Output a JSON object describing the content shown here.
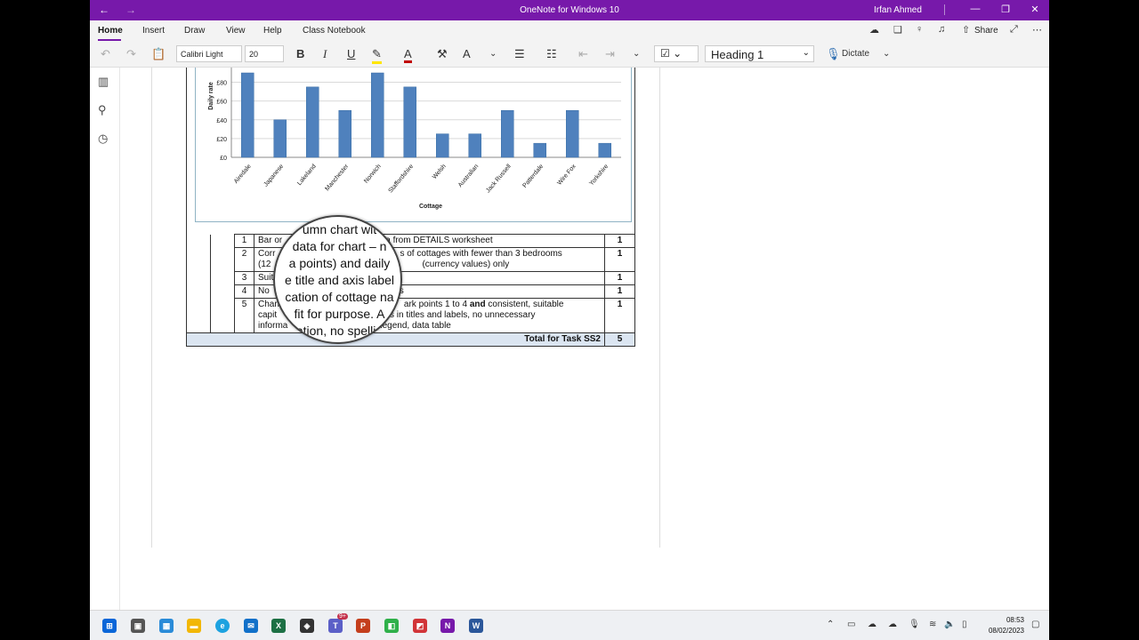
{
  "window": {
    "title": "OneNote for Windows 10",
    "user": "Irfan Ahmed"
  },
  "menu": {
    "items": [
      "Home",
      "Insert",
      "Draw",
      "View",
      "Help",
      "Class Notebook"
    ],
    "share": "Share"
  },
  "ribbon": {
    "font_name": "Calibri Light",
    "font_size": "20",
    "style": "Heading 1",
    "dictate": "Dictate"
  },
  "chart_data": {
    "type": "bar",
    "categories": [
      "Airedale",
      "Japanese",
      "Lakeland",
      "Manchester",
      "Norwich",
      "Staffordshire",
      "Welsh",
      "Australian",
      "Jack Russell",
      "Patterdale",
      "Wire Fox",
      "Yorkshire"
    ],
    "values": [
      90,
      40,
      75,
      50,
      90,
      75,
      25,
      25,
      50,
      15,
      50,
      15
    ],
    "yticks": [
      "£0",
      "£20",
      "£40",
      "£60",
      "£80"
    ],
    "ylim": [
      0,
      90
    ],
    "xlabel": "Cottage",
    "ylabel": "Daily rate",
    "bar_color": "#4f81bd"
  },
  "markscheme": {
    "rows": [
      {
        "n": "1",
        "text": "Bar or column chart with data from DETAILS worksheet",
        "shown": "Bar or",
        "tail": "a from DETAILS worksheet",
        "mark": "1"
      },
      {
        "n": "2",
        "text": "Correct ... s of cottages with fewer than 3 bedrooms (12 ... (currency values) only",
        "shown": "Corr",
        "tail": "s of cottages with fewer than 3 bedrooms",
        "line2a": "(12",
        "line2b": "(currency values) only",
        "mark": "1"
      },
      {
        "n": "3",
        "text": "Suitable title and axis labels",
        "shown": "Suit",
        "tail": "",
        "mark": "1"
      },
      {
        "n": "4",
        "text": "No ...",
        "shown": "No",
        "tail": "s",
        "mark": "1"
      },
      {
        "n": "5",
        "text": "Chart ... mark points 1 to 4 and consistent, suitable",
        "shown": "Chan",
        "tail": "ark points 1 to 4",
        "bold": "and",
        "tail2": "consistent, suitable",
        "line2a": "capit",
        "line2b": "ors in titles and labels, no unnecessary",
        "line3a": "informa",
        "line3b": "legend, data table",
        "mark": "1"
      }
    ],
    "total_label": "Total for Task SS2",
    "total": "5"
  },
  "magnifier": {
    "lines": [
      "umn chart wit",
      "data for chart – n",
      "a points) and daily",
      "e title and axis label",
      "cation of cottage na",
      "fit for purpose. A",
      "ation, no spellin",
      "data"
    ]
  },
  "taskbar": {
    "time": "08:53",
    "date": "08/02/2023",
    "teams_badge": "9+"
  }
}
